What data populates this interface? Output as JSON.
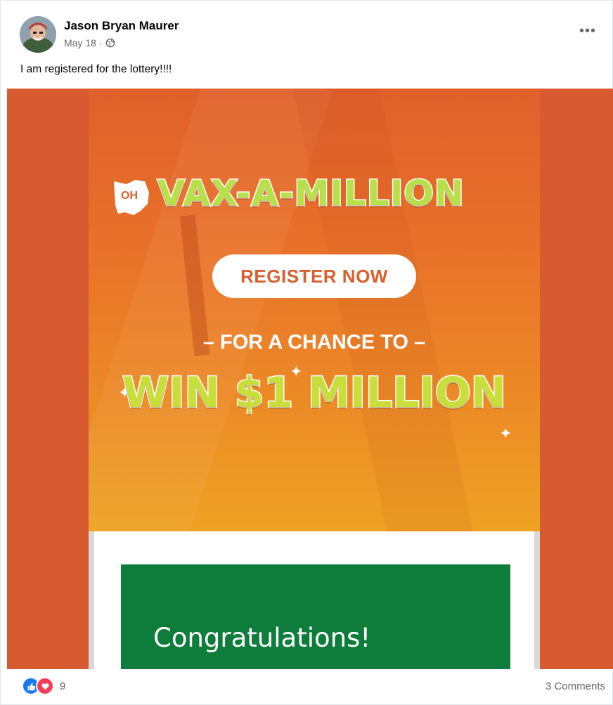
{
  "post": {
    "author": "Jason Bryan Maurer",
    "date": "May 18",
    "separator": "·",
    "privacy_icon": "globe-icon",
    "more_icon": "more-options-icon",
    "more_label": "•••",
    "caption": "I am registered for the lottery!!!!"
  },
  "media": {
    "logo_state": "OH",
    "title": "VAX-A-MILLION",
    "button": "REGISTER NOW",
    "subtitle": "– FOR A CHANCE TO –",
    "prize": "WIN $1 MILLION",
    "card_message": "Congratulations!",
    "colors": {
      "background": "#d75a30",
      "orange": "#e8712a",
      "title_green": "#b7e04a",
      "card_green": "#0e7c3a"
    }
  },
  "footer": {
    "reaction_icons": [
      "like-icon",
      "love-icon"
    ],
    "reaction_count": "9",
    "comments": "3 Comments"
  }
}
